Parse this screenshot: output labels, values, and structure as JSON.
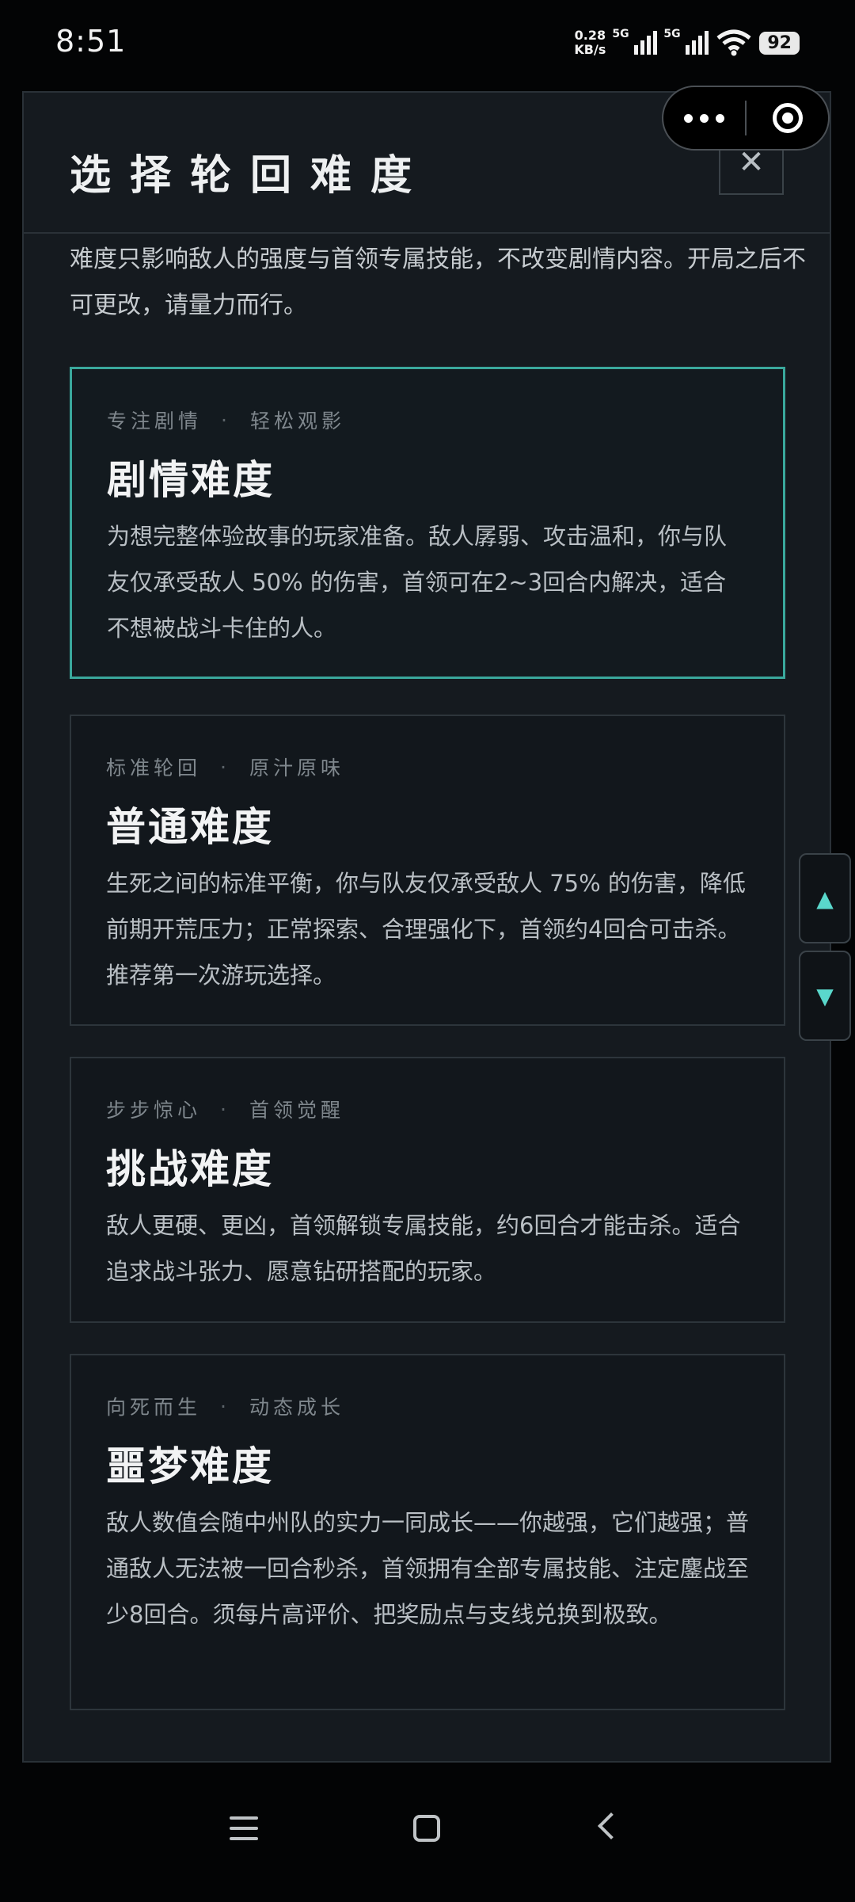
{
  "status": {
    "time": "8:51",
    "net_speed_value": "0.28",
    "net_speed_unit": "KB/s",
    "signal1_label": "5G",
    "signal2_label": "5G",
    "battery": "92"
  },
  "dialog": {
    "title": "选择轮回难度",
    "close_icon": "✕",
    "intro": "难度只影响敌人的强度与首领专属技能，不改变剧情内容。开局之后不可更改，请量力而行。"
  },
  "difficulties": [
    {
      "tag1": "专注剧情",
      "tag2": "轻松观影",
      "title": "剧情难度",
      "description": "为想完整体验故事的玩家准备。敌人孱弱、攻击温和，你与队友仅承受敌人 50% 的伤害，首领可在2~3回合内解决，适合不想被战斗卡住的人。",
      "selected": true
    },
    {
      "tag1": "标准轮回",
      "tag2": "原汁原味",
      "title": "普通难度",
      "description": "生死之间的标准平衡，你与队友仅承受敌人 75% 的伤害，降低前期开荒压力；正常探索、合理强化下，首领约4回合可击杀。推荐第一次游玩选择。",
      "selected": false
    },
    {
      "tag1": "步步惊心",
      "tag2": "首领觉醒",
      "title": "挑战难度",
      "description": "敌人更硬、更凶，首领解锁专属技能，约6回合才能击杀。适合追求战斗张力、愿意钻研搭配的玩家。",
      "selected": false
    },
    {
      "tag1": "向死而生",
      "tag2": "动态成长",
      "title": "噩梦难度",
      "description": "敌人数值会随中州队的实力一同成长——你越强，它们越强；普通敌人无法被一回合秒杀，首领拥有全部专属技能、注定鏖战至少8回合。须每片高评价、把奖励点与支线兑换到极致。",
      "selected": false
    }
  ],
  "scroll": {
    "up_icon": "▲",
    "down_icon": "▼"
  },
  "colors": {
    "accent": "#3aa89c",
    "panel_bg": "#151a1f",
    "card_bg": "#12171c"
  }
}
